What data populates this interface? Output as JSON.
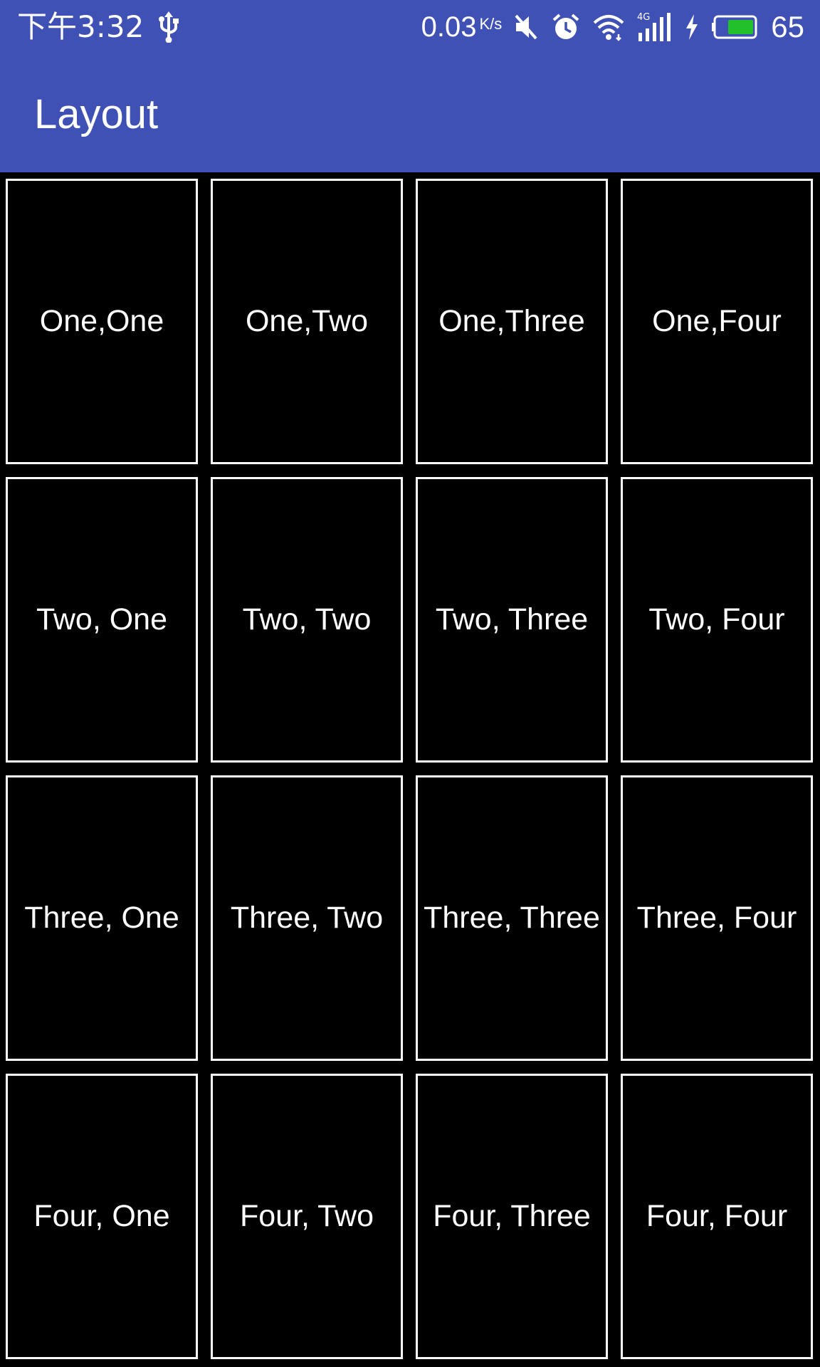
{
  "status_bar": {
    "time": "下午3:32",
    "net_speed": "0.03",
    "net_unit": "K/s",
    "battery_percent": "65",
    "icons": [
      "usb-icon",
      "mute-icon",
      "alarm-icon",
      "wifi-icon",
      "signal-4g-icon",
      "charging-icon",
      "battery-icon"
    ],
    "battery_color": "#22C02A"
  },
  "app_bar": {
    "title": "Layout",
    "color": "#3F51B5"
  },
  "grid": {
    "rows": [
      [
        "One,One",
        "One,Two",
        "One,Three",
        "One,Four"
      ],
      [
        "Two, One",
        "Two, Two",
        "Two, Three",
        "Two, Four"
      ],
      [
        "Three, One",
        "Three, Two",
        "Three, Three",
        "Three, Four"
      ],
      [
        "Four, One",
        "Four, Two",
        "Four, Three",
        "Four, Four"
      ]
    ]
  }
}
